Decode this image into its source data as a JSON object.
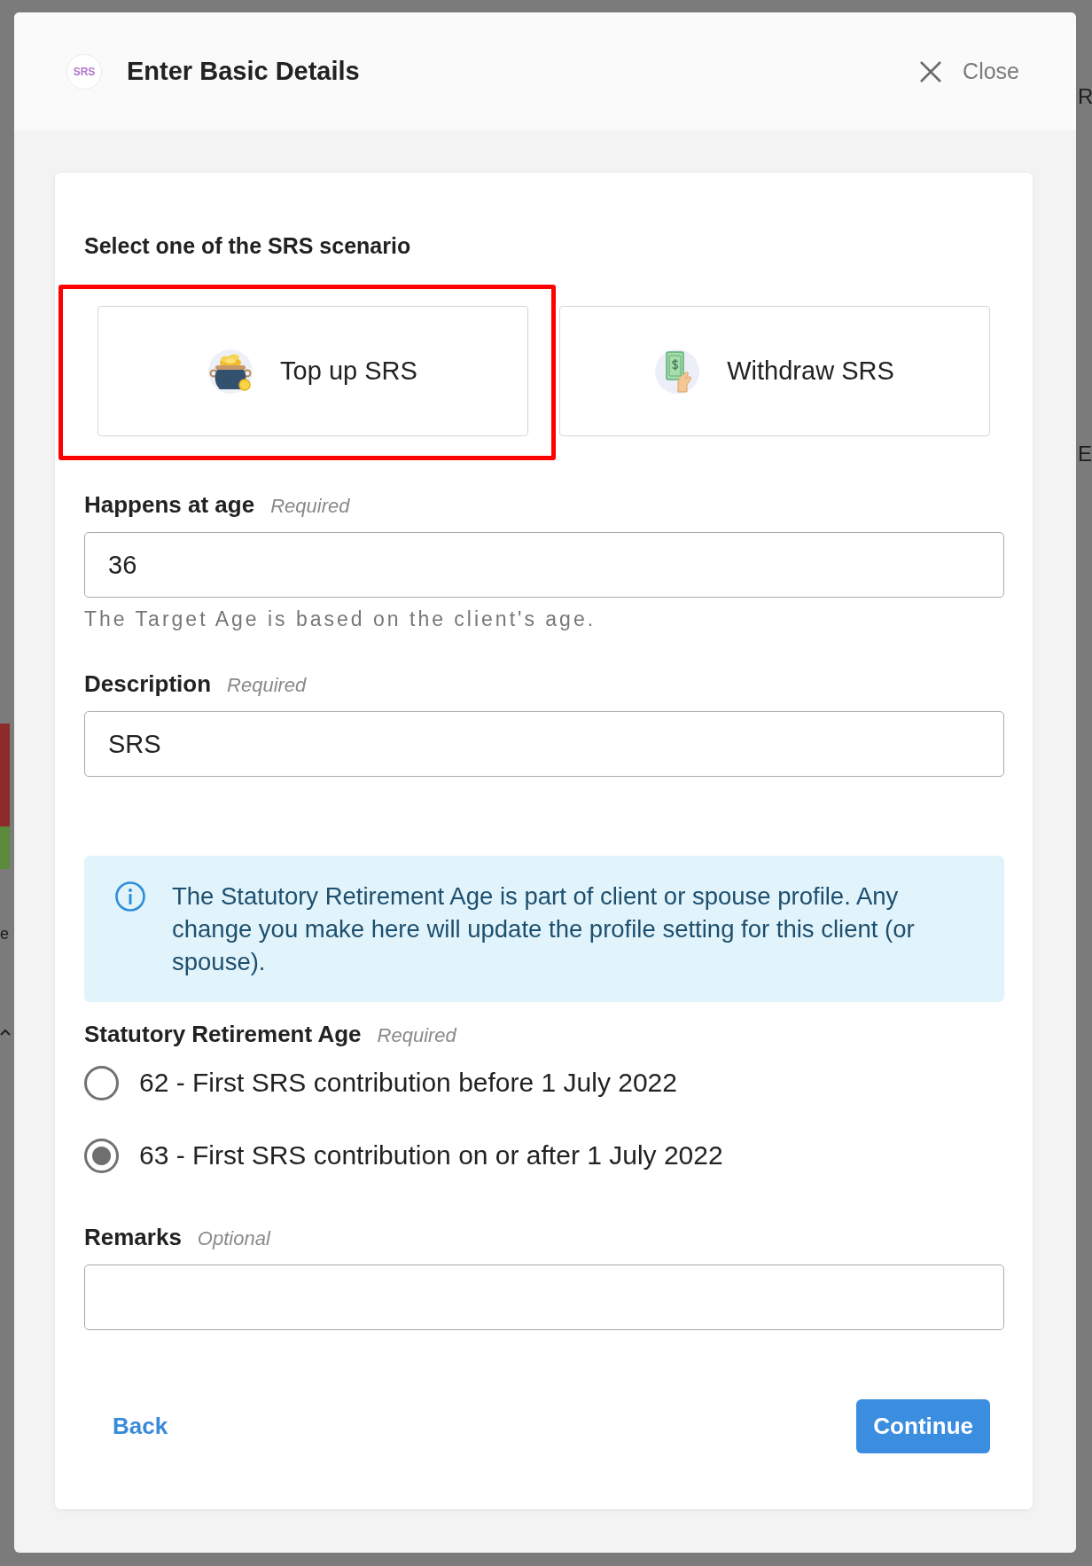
{
  "background": {
    "right_edge_texts": [
      "R",
      "E"
    ],
    "left_edge_texts": [
      "e"
    ]
  },
  "modal": {
    "logo_text": "SRS",
    "title": "Enter Basic Details",
    "close_label": "Close"
  },
  "scenario": {
    "prompt": "Select one of the SRS scenario",
    "options": [
      {
        "kind": "top-up",
        "label": "Top up SRS",
        "selected": false,
        "highlighted": true
      },
      {
        "kind": "withdraw",
        "label": "Withdraw SRS",
        "selected": false,
        "highlighted": false
      }
    ]
  },
  "age_field": {
    "label": "Happens at age",
    "tag": "Required",
    "value": "36",
    "hint": "The Target Age is based on the client's age."
  },
  "description_field": {
    "label": "Description",
    "tag": "Required",
    "value": "SRS"
  },
  "notice": {
    "text": "The Statutory Retirement Age is part of client or spouse profile. Any change you make here will update the profile setting for this client (or spouse)."
  },
  "retirement_age": {
    "label": "Statutory Retirement Age",
    "tag": "Required",
    "options": [
      {
        "label": "62 - First SRS contribution before 1 July 2022",
        "selected": false
      },
      {
        "label": "63 - First SRS contribution on or after 1 July 2022",
        "selected": true
      }
    ]
  },
  "remarks_field": {
    "label": "Remarks",
    "tag": "Optional"
  },
  "actions": {
    "back": "Back",
    "continue": "Continue"
  }
}
